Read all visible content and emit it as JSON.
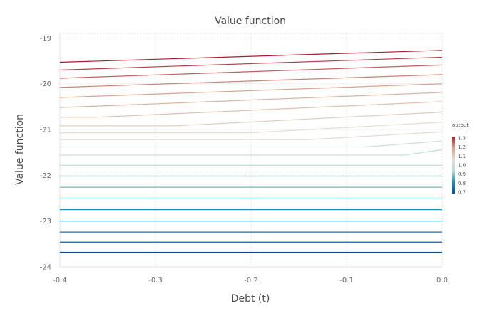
{
  "chart_data": {
    "type": "line",
    "title": "Value function",
    "xlabel": "Debt (t)",
    "ylabel": "Value function",
    "xlim": [
      -0.4,
      0.0
    ],
    "ylim": [
      -24.0,
      -18.9
    ],
    "x_ticks": [
      -0.4,
      -0.3,
      -0.2,
      -0.1,
      0.0
    ],
    "x_tick_labels": [
      "-0.4",
      "-0.3",
      "-0.2",
      "-0.1",
      "0.0"
    ],
    "y_ticks": [
      -19,
      -20,
      -21,
      -22,
      -23,
      -24
    ],
    "y_tick_labels": [
      "-19",
      "-20",
      "-21",
      "-22",
      "-23",
      "-24"
    ],
    "grid": true,
    "legend": {
      "title": "output",
      "placement": "right",
      "min": 0.7,
      "max": 1.3,
      "ticks": [
        "1.3",
        "1.2",
        "1.1",
        "1.0",
        "0.9",
        "0.8",
        "0.7"
      ],
      "colors": [
        "#b2182b",
        "#d6a48c",
        "#e3ddd3",
        "#b9ddd7",
        "#1f8fb9",
        "#08519c"
      ]
    },
    "series": [
      {
        "output": 1.3,
        "x": [
          -0.4,
          0.0
        ],
        "y": [
          -19.53,
          -19.27
        ]
      },
      {
        "output": 1.27,
        "x": [
          -0.4,
          0.0
        ],
        "y": [
          -19.7,
          -19.42
        ]
      },
      {
        "output": 1.24,
        "x": [
          -0.4,
          0.0
        ],
        "y": [
          -19.88,
          -19.59
        ]
      },
      {
        "output": 1.21,
        "x": [
          -0.4,
          0.0
        ],
        "y": [
          -20.08,
          -19.8
        ]
      },
      {
        "output": 1.18,
        "x": [
          -0.4,
          0.0
        ],
        "y": [
          -20.3,
          -20.0
        ]
      },
      {
        "output": 1.15,
        "x": [
          -0.4,
          0.0
        ],
        "y": [
          -20.52,
          -20.19
        ]
      },
      {
        "output": 1.12,
        "x": [
          -0.4,
          -0.36,
          0.0
        ],
        "y": [
          -20.73,
          -20.73,
          -20.39
        ]
      },
      {
        "output": 1.09,
        "x": [
          -0.4,
          -0.28,
          0.0
        ],
        "y": [
          -20.92,
          -20.92,
          -20.62
        ]
      },
      {
        "output": 1.06,
        "x": [
          -0.4,
          -0.2,
          0.0
        ],
        "y": [
          -21.07,
          -21.07,
          -20.84
        ]
      },
      {
        "output": 1.03,
        "x": [
          -0.4,
          -0.14,
          0.0
        ],
        "y": [
          -21.22,
          -21.22,
          -21.05
        ]
      },
      {
        "output": 1.0,
        "x": [
          -0.4,
          -0.08,
          0.0
        ],
        "y": [
          -21.38,
          -21.38,
          -21.25
        ]
      },
      {
        "output": 0.97,
        "x": [
          -0.4,
          -0.04,
          0.0
        ],
        "y": [
          -21.56,
          -21.56,
          -21.44
        ]
      },
      {
        "output": 0.94,
        "x": [
          -0.4,
          0.0
        ],
        "y": [
          -21.78,
          -21.78
        ]
      },
      {
        "output": 0.91,
        "x": [
          -0.4,
          0.0
        ],
        "y": [
          -22.02,
          -22.02
        ]
      },
      {
        "output": 0.88,
        "x": [
          -0.4,
          0.0
        ],
        "y": [
          -22.26,
          -22.26
        ]
      },
      {
        "output": 0.85,
        "x": [
          -0.4,
          0.0
        ],
        "y": [
          -22.5,
          -22.5
        ]
      },
      {
        "output": 0.82,
        "x": [
          -0.4,
          0.0
        ],
        "y": [
          -22.75,
          -22.75
        ]
      },
      {
        "output": 0.79,
        "x": [
          -0.4,
          0.0
        ],
        "y": [
          -23.0,
          -23.0
        ]
      },
      {
        "output": 0.76,
        "x": [
          -0.4,
          0.0
        ],
        "y": [
          -23.24,
          -23.24
        ]
      },
      {
        "output": 0.73,
        "x": [
          -0.4,
          0.0
        ],
        "y": [
          -23.46,
          -23.46
        ]
      },
      {
        "output": 0.7,
        "x": [
          -0.4,
          0.0
        ],
        "y": [
          -23.68,
          -23.68
        ]
      }
    ]
  }
}
